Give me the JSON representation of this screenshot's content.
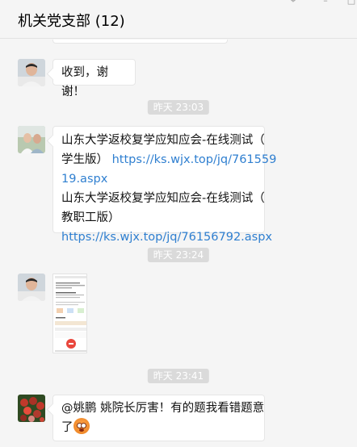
{
  "header": {
    "title": "机关党支部 (12)"
  },
  "window_controls": {
    "pin_icon": "pin-icon",
    "min_icon": "minimize-icon",
    "max_icon": "maximize-icon"
  },
  "messages": [
    {
      "type": "text",
      "text": "收到，谢谢！"
    },
    {
      "type": "timestamp",
      "text": "昨天 23:03"
    },
    {
      "type": "text",
      "line1": "山东大学返校复学应知应会-在线测试（",
      "line2_prefix": "学生版）",
      "line2_link": "https://ks.wjx.top/jq/761559",
      "line3_link": "19.aspx",
      "line4": "山东大学返校复学应知应会-在线测试（",
      "line5": "教职工版）",
      "line6_link": "https://ks.wjx.top/jq/76156792.aspx"
    },
    {
      "type": "timestamp",
      "text": "昨天 23:24"
    },
    {
      "type": "image",
      "description_icon": "screenshot-thumbnail"
    },
    {
      "type": "timestamp",
      "text": "昨天 23:41"
    },
    {
      "type": "text",
      "line1": "@姚鹏 姚院长厉害！有的题我看错题意",
      "line2": "了",
      "emoji": "blushing-face-icon"
    }
  ],
  "colors": {
    "link": "#2f7fd0",
    "timestamp_bg": "#dadada",
    "background": "#f5f5f5"
  }
}
